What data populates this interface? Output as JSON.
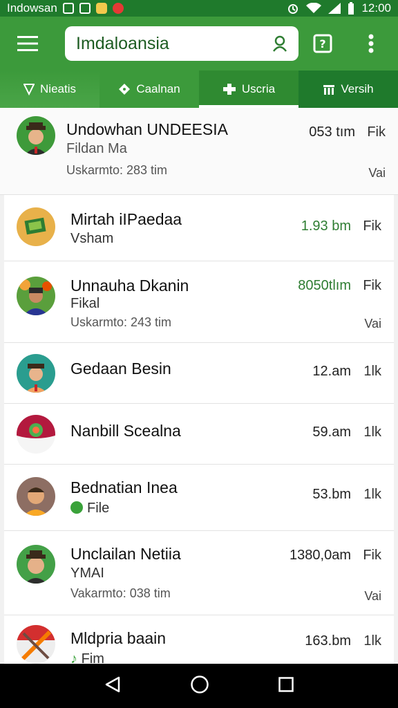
{
  "status_bar": {
    "carrier": "Indowsan",
    "time": "12:00"
  },
  "search": {
    "value": "Imdaloansia"
  },
  "tabs": [
    {
      "label": "Nieatis"
    },
    {
      "label": "Caalnan"
    },
    {
      "label": "Uscria"
    },
    {
      "label": "Versih"
    }
  ],
  "colors": {
    "primary": "#3c9a3b",
    "dark": "#1f7a2c",
    "accent_text": "#2e7d32"
  },
  "items": [
    {
      "title": "Undowhan UNDEESIA",
      "subtitle": "Fildan Ma",
      "meta": "Uskarmto: 283 tim",
      "time": "053 tım",
      "kind": "Fik",
      "extra": "Vai"
    },
    {
      "title": "Mirtah iIPaedaa",
      "subtitle": "Vsham",
      "time": "1.93 bm",
      "kind": "Fik"
    },
    {
      "title": "Unnauha Dkanin",
      "subtitle": "Fikal",
      "meta": "Uskarmto: 243 tim",
      "time": "8050tlım",
      "kind": "Fik",
      "extra": "Vai"
    },
    {
      "title": "Gedaan Besin",
      "time": "12.am",
      "kind": "1lk"
    },
    {
      "title": "Nanbill Scealna",
      "time": "59.am",
      "kind": "1lk"
    },
    {
      "title": "Bednatian Inea",
      "subtitle": "File",
      "time": "53.bm",
      "kind": "1lk"
    },
    {
      "title": "Unclailan Netiia",
      "subtitle": "YMAI",
      "meta": "Vakarmto: 038 tim",
      "time": "1380,0am",
      "kind": "Fik",
      "extra": "Vai"
    },
    {
      "title": "Mldpria baain",
      "subtitle": "Fim",
      "time": "163.bm",
      "kind": "1lk"
    }
  ]
}
